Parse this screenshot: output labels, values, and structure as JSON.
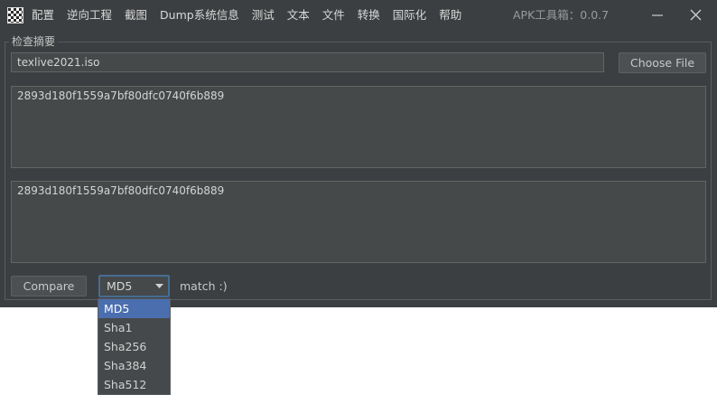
{
  "menu": [
    "配置",
    "逆向工程",
    "截图",
    "Dump系统信息",
    "测试",
    "文本",
    "文件",
    "转换",
    "国际化",
    "帮助"
  ],
  "app_title": "APK工具箱：0.0.7",
  "panel": {
    "title": "检查摘要",
    "file_path": "texlive2021.iso",
    "choose_file_label": "Choose File",
    "hash_input": "2893d180f1559a7bf80dfc0740f6b889",
    "hash_computed": "2893d180f1559a7bf80dfc0740f6b889",
    "compare_label": "Compare",
    "algorithm_selected": "MD5",
    "status": "match :)"
  },
  "dropdown": {
    "options": [
      "MD5",
      "Sha1",
      "Sha256",
      "Sha384",
      "Sha512"
    ],
    "selected_index": 0
  },
  "colors": {
    "window_bg": "#3c3f41",
    "field_bg": "#45494a",
    "selection": "#4b6eaf",
    "focus_border": "#466d94"
  }
}
